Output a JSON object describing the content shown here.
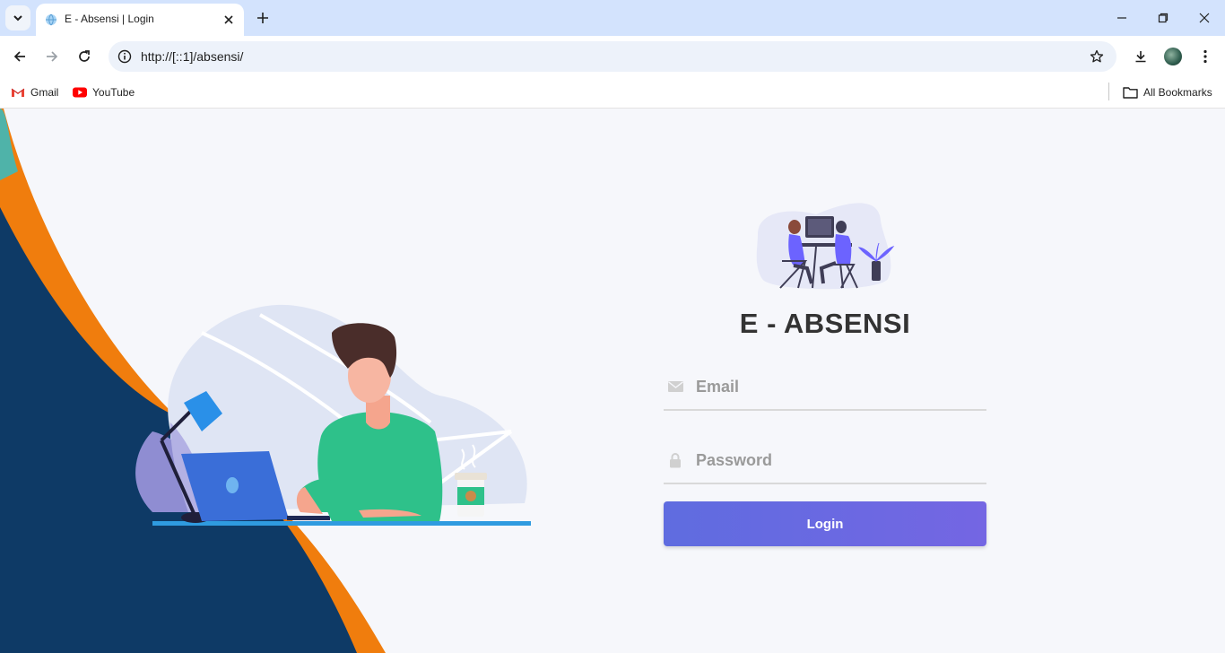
{
  "browser": {
    "tab_title": "E - Absensi | Login",
    "url": "http://[::1]/absensi/",
    "bookmarks": [
      {
        "label": "Gmail",
        "icon": "gmail-icon"
      },
      {
        "label": "YouTube",
        "icon": "youtube-icon"
      }
    ],
    "all_bookmarks_label": "All Bookmarks"
  },
  "login": {
    "title": "E - ABSENSI",
    "email_placeholder": "Email",
    "password_placeholder": "Password",
    "login_label": "Login",
    "accent": "#6a68e1"
  },
  "colors": {
    "navy": "#0e3a66",
    "orange": "#f07d0d",
    "teal": "#4fb3a9"
  }
}
